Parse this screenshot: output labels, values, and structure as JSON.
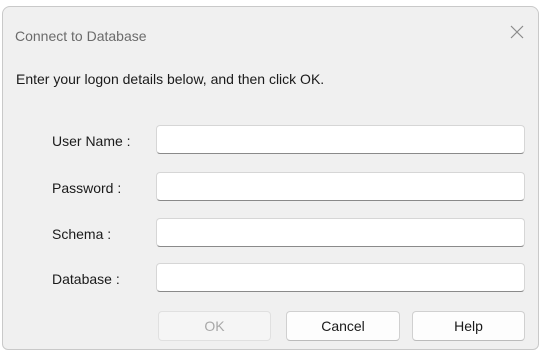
{
  "window": {
    "title": "Connect to Database"
  },
  "instructions": "Enter your logon details below, and then click OK.",
  "fields": [
    {
      "label": "User Name :",
      "value": ""
    },
    {
      "label": "Password :",
      "value": ""
    },
    {
      "label": "Schema :",
      "value": ""
    },
    {
      "label": "Database :",
      "value": ""
    }
  ],
  "buttons": {
    "ok": "OK",
    "cancel": "Cancel",
    "help": "Help"
  },
  "icons": {
    "close": "close-icon"
  },
  "colors": {
    "dialog_bg": "#f0f0f0",
    "title_text": "#6b6b6b",
    "disabled_text": "#a8a8a8"
  }
}
